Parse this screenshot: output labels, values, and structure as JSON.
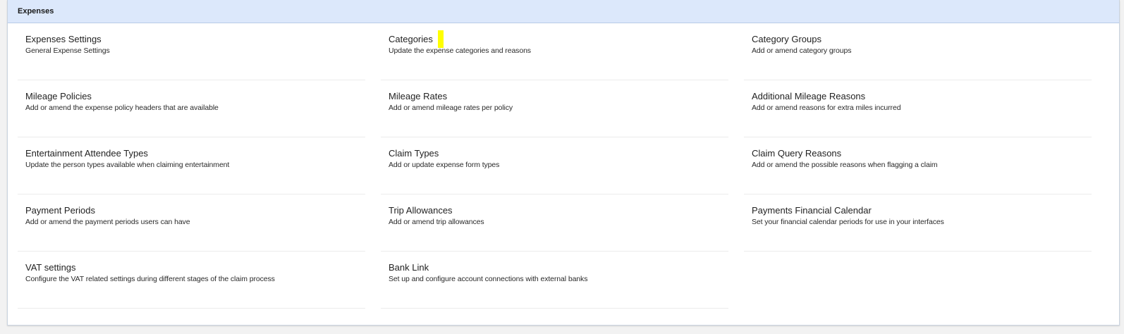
{
  "panel": {
    "title": "Expenses"
  },
  "colors": {
    "header_bg": "#dce8fb",
    "highlight": "#ffff00"
  },
  "tiles": [
    {
      "title": "Expenses Settings",
      "description": "General Expense Settings"
    },
    {
      "title": "Categories",
      "description": "Update the expense categories and reasons"
    },
    {
      "title": "Category Groups",
      "description": "Add or amend category groups"
    },
    {
      "title": "Mileage Policies",
      "description": "Add or amend the expense policy headers that are available"
    },
    {
      "title": "Mileage Rates",
      "description": "Add or amend mileage rates per policy"
    },
    {
      "title": "Additional Mileage Reasons",
      "description": "Add or amend reasons for extra miles incurred"
    },
    {
      "title": "Entertainment Attendee Types",
      "description": "Update the person types available when claiming entertainment"
    },
    {
      "title": "Claim Types",
      "description": "Add or update expense form types"
    },
    {
      "title": "Claim Query Reasons",
      "description": "Add or amend the possible reasons when flagging a claim"
    },
    {
      "title": "Payment Periods",
      "description": "Add or amend the payment periods users can have"
    },
    {
      "title": "Trip Allowances",
      "description": "Add or amend trip allowances"
    },
    {
      "title": "Payments Financial Calendar",
      "description": "Set your financial calendar periods for use in your interfaces"
    },
    {
      "title": "VAT settings",
      "description": "Configure the VAT related settings during different stages of the claim process"
    },
    {
      "title": "Bank Link",
      "description": "Set up and configure account connections with external banks"
    }
  ]
}
